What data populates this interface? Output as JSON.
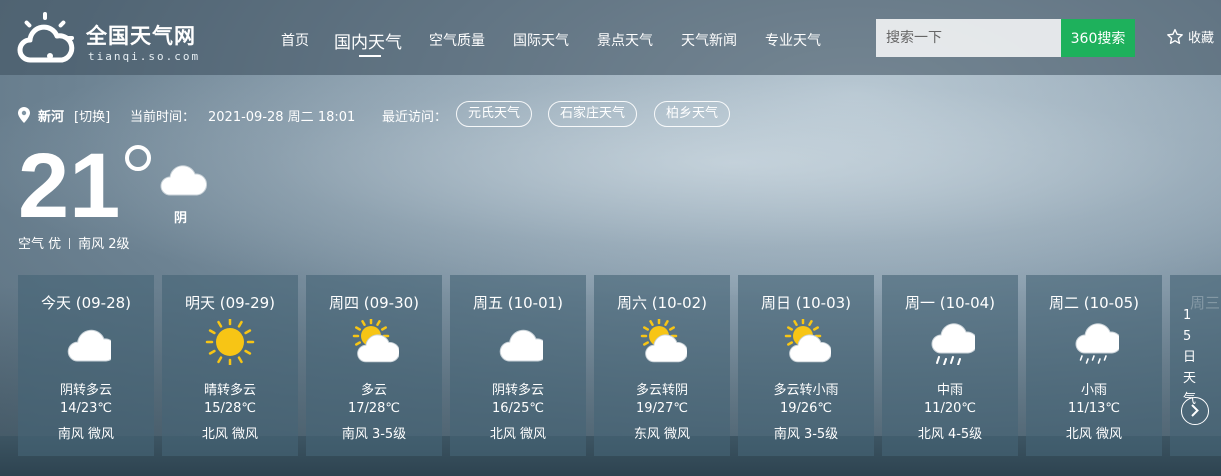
{
  "header": {
    "logo_title": "全国天气网",
    "logo_sub": "tianqi.so.com",
    "nav": [
      "首页",
      "国内天气",
      "空气质量",
      "国际天气",
      "景点天气",
      "天气新闻",
      "专业天气"
    ],
    "search_placeholder": "搜索一下",
    "search_button": "360搜索",
    "favorite": "收藏"
  },
  "info": {
    "city": "新河",
    "switch": "[切换]",
    "time_label": "当前时间：",
    "time_value": "2021-09-28  周二  18:01",
    "recent_label": "最近访问：",
    "recent": [
      "元氏天气",
      "石家庄天气",
      "柏乡天气"
    ]
  },
  "current": {
    "temperature": "21",
    "weather": "阴",
    "air_quality": "空气 优",
    "wind": "南风 2级"
  },
  "forecast": [
    {
      "date": "今天 (09-28)",
      "icon": "cloudy-icon",
      "desc": "阴转多云",
      "temp": "14/23℃",
      "wind": "南风 微风"
    },
    {
      "date": "明天 (09-29)",
      "icon": "sunny-icon",
      "desc": "晴转多云",
      "temp": "15/28℃",
      "wind": "北风 微风"
    },
    {
      "date": "周四 (09-30)",
      "icon": "partly-cloudy-icon",
      "desc": "多云",
      "temp": "17/28℃",
      "wind": "南风 3-5级"
    },
    {
      "date": "周五 (10-01)",
      "icon": "cloudy-icon",
      "desc": "阴转多云",
      "temp": "16/25℃",
      "wind": "北风 微风"
    },
    {
      "date": "周六 (10-02)",
      "icon": "partly-cloudy-icon",
      "desc": "多云转阴",
      "temp": "19/27℃",
      "wind": "东风 微风"
    },
    {
      "date": "周日 (10-03)",
      "icon": "partly-cloudy-icon",
      "desc": "多云转小雨",
      "temp": "19/26℃",
      "wind": "南风 3-5级"
    },
    {
      "date": "周一 (10-04)",
      "icon": "moderate-rain-icon",
      "desc": "中雨",
      "temp": "11/20℃",
      "wind": "北风 4-5级"
    },
    {
      "date": "周二 (10-05)",
      "icon": "light-rain-icon",
      "desc": "小雨",
      "temp": "11/13℃",
      "wind": "北风 微风"
    }
  ],
  "more": {
    "ghost": "周三",
    "label": "15日天气"
  },
  "colors": {
    "search_button": "#1eb15c",
    "sun": "#f7c515"
  }
}
